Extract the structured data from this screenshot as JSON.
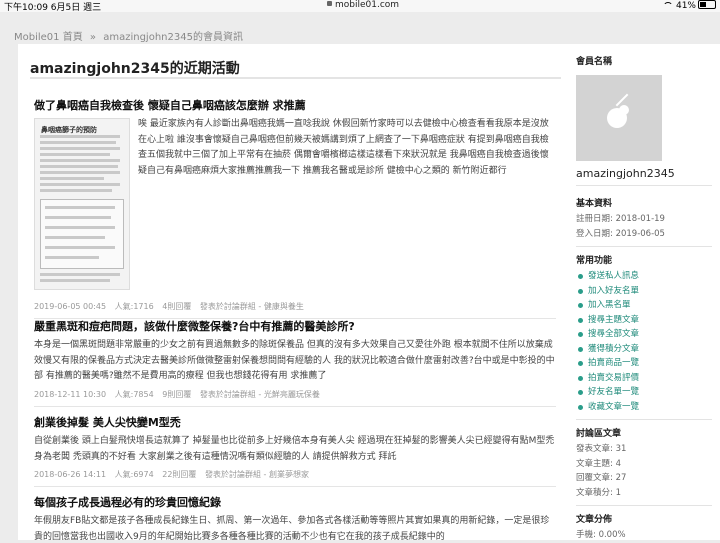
{
  "status": {
    "time": "下午10:09  6月5日 週三",
    "url": "mobile01.com",
    "battery": "41%"
  },
  "breadcrumb": {
    "home": "Mobile01 首頁",
    "sep": "»",
    "current": "amazingjohn2345的會員資訊"
  },
  "main": {
    "title": "amazingjohn2345的近期活動",
    "posts": [
      {
        "title": "做了鼻咽癌自我檢查後 懷疑自己鼻咽癌該怎麼辦 求推薦",
        "body": "唉 最近家族內有人診斷出鼻咽癌我媽一直唸我說 休假回新竹家時可以去健檢中心檢查看看我原本是沒放在心上啦 誰沒事會懷疑自己鼻咽癌但前幾天被媽講到煩了上網查了一下鼻咽癌症狀 有提到鼻咽癌自我檢查五個我就中三個了加上平常有在抽菸 偶爾會嚼檳榔這樣這樣看下來狀況就是 我鼻咽癌自我檢查過後懷疑自己有鼻咽癌麻煩大家推薦推薦我一下 推薦我名醫或是診所 健檢中心之類的 新竹附近都行",
        "meta": [
          "2019-06-05 00:45",
          "人氣:1716",
          "4則回覆",
          "發表於討論群組 - 健康與養生"
        ],
        "thumb_title": "鼻咽癌篩子的預防"
      },
      {
        "title": "嚴重黑斑和痘疤問題，該做什麼微整保養?台中有推薦的醫美診所?",
        "body": "本身是一個黑斑問題非常嚴重的少女之前有買過無數多的除斑保養品 但真的沒有多大效果自己又愛往外跑 根本就間不住所以放棄成效慢又有限的保養品方式決定去醫美診所做微整雷射保養想問問有經驗的人 我的狀況比較適合做什麼雷射改善?台中或是中彰投的中部 有推薦的醫美嗎?雖然不是費用高的療程 但我也想錢花得有用 求推薦了",
        "meta": [
          "2018-12-11 10:30",
          "人氣:7854",
          "9則回覆",
          "發表於討論群組 - 光鮮亮麗玩保養"
        ]
      },
      {
        "title": "創業後掉髮 美人尖快變M型禿",
        "body": "自從創業後 頭上白髮飛快增長這就算了 掉髮量也比從前多上好幾倍本身有美人尖 經過現在狂掉髮的影響美人尖已經變得有點M型禿身為老闆 禿頭真的不好看 大家創業之後有這種情況嗎有類似經驗的人 請提供解救方式 拜託",
        "meta": [
          "2018-06-26 14:11",
          "人氣:6974",
          "22則回覆",
          "發表於討論群組 - 創業夢想家"
        ]
      },
      {
        "title": "每個孩子成長過程必有的珍貴回憶紀錄",
        "body": "年假朋友FB貼文都是孩子各種成長紀錄生日、抓周、第一次過年、參加各式各樣活動等等照片其實如果真的用新紀錄，一定是很珍貴的回憶當我也出國收入9月的年紀開始比賽多各種各種比賽的活動不少也有它在我的孩子成長紀錄中的",
        "meta": []
      }
    ]
  },
  "sidebar": {
    "member_name_label": "會員名稱",
    "username": "amazingjohn2345",
    "basic_label": "基本資料",
    "register_date": "註冊日期: 2018-01-19",
    "login_date": "登入日期: 2019-06-05",
    "func_label": "常用功能",
    "functions": [
      "發送私人訊息",
      "加入好友名單",
      "加入黑名單",
      "搜尋主題文章",
      "搜尋全部文章",
      "獲得積分文章",
      "拍賣商品一覽",
      "拍賣交易評價",
      "好友名單一覽",
      "收藏文章一覽"
    ],
    "stats_label": "討論區文章",
    "stats": [
      "發表文章: 31",
      "文章主題: 4",
      "回覆文章: 27",
      "文章積分: 1"
    ],
    "dist_label": "文章分佈",
    "dist": [
      "手機: 0.00%"
    ]
  }
}
